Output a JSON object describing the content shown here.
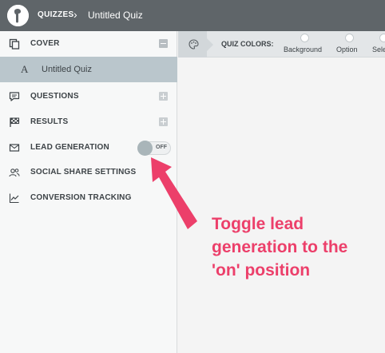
{
  "header": {
    "breadcrumb_root": "QUIZZES",
    "breadcrumb_separator": "›",
    "breadcrumb_current": "Untitled Quiz"
  },
  "sidebar": {
    "items": [
      {
        "label": "COVER",
        "icon": "copy-icon",
        "expanded": true
      },
      {
        "label": "QUESTIONS",
        "icon": "comment-icon"
      },
      {
        "label": "RESULTS",
        "icon": "flag-icon"
      },
      {
        "label": "LEAD GENERATION",
        "icon": "envelope-icon",
        "toggle": {
          "state": "off",
          "label": "OFF"
        }
      },
      {
        "label": "SOCIAL SHARE SETTINGS",
        "icon": "users-icon"
      },
      {
        "label": "CONVERSION TRACKING",
        "icon": "line-chart-icon"
      }
    ],
    "cover_sub_item": {
      "letter": "A",
      "label": "Untitled Quiz"
    }
  },
  "colors_bar": {
    "label": "QUIZ COLORS:",
    "options": [
      {
        "label": "Background"
      },
      {
        "label": "Option"
      },
      {
        "label": "Sele"
      }
    ]
  },
  "annotation": {
    "text": "Toggle lead generation to the 'on' position",
    "color": "#ec3f6a"
  },
  "colors": {
    "topbar": "#5f6569",
    "selected_sub_item": "#bac6cc",
    "toggle_knob": "#a9b5b9"
  }
}
